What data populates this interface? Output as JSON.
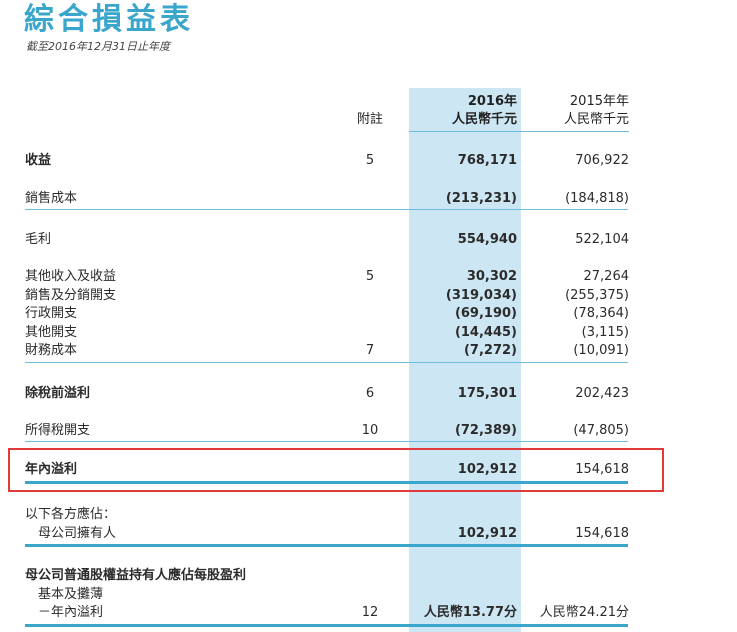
{
  "header": {
    "title": "綜合損益表",
    "subtitle": "截至2016年12月31日止年度"
  },
  "columns": {
    "note": "附註",
    "y2016_year": "2016年",
    "y2016_unit": "人民幣千元",
    "y2015_year": "2015年年",
    "y2015_unit": "人民幣千元"
  },
  "rows": [
    {
      "label": "收益",
      "note": "5",
      "v2016": "768,171",
      "v2015": "706,922"
    },
    {
      "label": "銷售成本",
      "note": "",
      "v2016": "(213,231)",
      "v2015": "(184,818)"
    },
    {
      "label": "毛利",
      "note": "",
      "v2016": "554,940",
      "v2015": "522,104"
    },
    {
      "label": "其他收入及收益",
      "note": "5",
      "v2016": "30,302",
      "v2015": "27,264"
    },
    {
      "label": "銷售及分銷開支",
      "note": "",
      "v2016": "(319,034)",
      "v2015": "(255,375)"
    },
    {
      "label": "行政開支",
      "note": "",
      "v2016": "(69,190)",
      "v2015": "(78,364)"
    },
    {
      "label": "其他開支",
      "note": "",
      "v2016": "(14,445)",
      "v2015": "(3,115)"
    },
    {
      "label": "財務成本",
      "note": "7",
      "v2016": "(7,272)",
      "v2015": "(10,091)"
    },
    {
      "label": "除稅前溢利",
      "note": "6",
      "v2016": "175,301",
      "v2015": "202,423"
    },
    {
      "label": "所得稅開支",
      "note": "10",
      "v2016": "(72,389)",
      "v2015": "(47,805)"
    },
    {
      "label": "年內溢利",
      "note": "",
      "v2016": "102,912",
      "v2015": "154,618"
    },
    {
      "label": "以下各方應佔：",
      "note": "",
      "v2016": "",
      "v2015": ""
    },
    {
      "label": "母公司擁有人",
      "note": "",
      "v2016": "102,912",
      "v2015": "154,618"
    },
    {
      "label": "母公司普通股權益持有人應佔每股盈利",
      "note": "",
      "v2016": "",
      "v2015": ""
    },
    {
      "label": "基本及攤薄",
      "note": "",
      "v2016": "",
      "v2015": ""
    },
    {
      "label": "－年內溢利",
      "note": "12",
      "v2016": "人民幣13.77分",
      "v2015": "人民幣24.21分"
    }
  ],
  "colors": {
    "title": "#3aa6cc",
    "column_highlight": "#cde6f3",
    "rule": "#3aa6cc",
    "annotation_box": "#e03a3a"
  }
}
